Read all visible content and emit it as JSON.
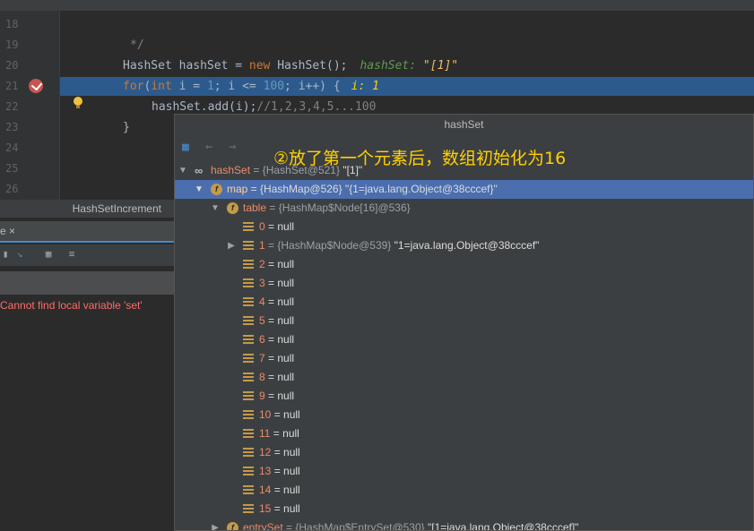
{
  "editor": {
    "lines": [
      {
        "no": "18"
      },
      {
        "no": "19"
      },
      {
        "no": "20"
      },
      {
        "no": "21"
      },
      {
        "no": "22"
      },
      {
        "no": "23"
      },
      {
        "no": "24"
      },
      {
        "no": "25"
      },
      {
        "no": "26"
      }
    ],
    "code": {
      "l19": "*/",
      "l20_type": "HashSet hashSet = ",
      "l20_new": "new",
      "l20_rest": " HashSet();",
      "l20_hint_label": "hashSet:",
      "l20_hint_val": "\"[1]\"",
      "l21_for": "for",
      "l21_open": "(",
      "l21_int": "int",
      "l21_i1": " i = ",
      "l21_one": "1",
      "l21_mid": "; i <= ",
      "l21_hundred": "100",
      "l21_end": "; i++) {",
      "l21_hint": "i: 1",
      "l22_code": "hashSet.add(i);",
      "l22_cmt": "//1,2,3,4,5...100",
      "l23": "}"
    }
  },
  "left_panel": {
    "title": "HashSetIncrement",
    "tab_label": "e ×",
    "error": "Cannot find local variable 'set'"
  },
  "popup": {
    "title": "hashSet",
    "annotation": "②放了第一个元素后，数组初始化为16",
    "tree": {
      "root": {
        "name": "hashSet",
        "value": " = {HashSet@521} ",
        "str": "\"[1]\""
      },
      "map": {
        "name": "map",
        "value": " = {HashMap@526} ",
        "str": "\"{1=java.lang.Object@38cccef}\""
      },
      "table": {
        "name": "table",
        "value": " = {HashMap$Node[16]@536}"
      },
      "nodes": [
        {
          "idx": "0",
          "val": " = null"
        },
        {
          "idx": "1",
          "val": " = {HashMap$Node@539} ",
          "str": "\"1=java.lang.Object@38cccef\""
        },
        {
          "idx": "2",
          "val": " = null"
        },
        {
          "idx": "3",
          "val": " = null"
        },
        {
          "idx": "4",
          "val": " = null"
        },
        {
          "idx": "5",
          "val": " = null"
        },
        {
          "idx": "6",
          "val": " = null"
        },
        {
          "idx": "7",
          "val": " = null"
        },
        {
          "idx": "8",
          "val": " = null"
        },
        {
          "idx": "9",
          "val": " = null"
        },
        {
          "idx": "10",
          "val": " = null"
        },
        {
          "idx": "11",
          "val": " = null"
        },
        {
          "idx": "12",
          "val": " = null"
        },
        {
          "idx": "13",
          "val": " = null"
        },
        {
          "idx": "14",
          "val": " = null"
        },
        {
          "idx": "15",
          "val": " = null"
        }
      ],
      "entrySet": {
        "name": "entrySet",
        "value": " = {HashMap$EntrySet@530} ",
        "str": "\"[1=java.lang.Object@38cccef]\""
      }
    }
  },
  "colors": {
    "current_line": "#2d5a8c",
    "selected_row": "#4b6eaf",
    "annotation": "#ffd000",
    "error": "#ff6b68"
  }
}
